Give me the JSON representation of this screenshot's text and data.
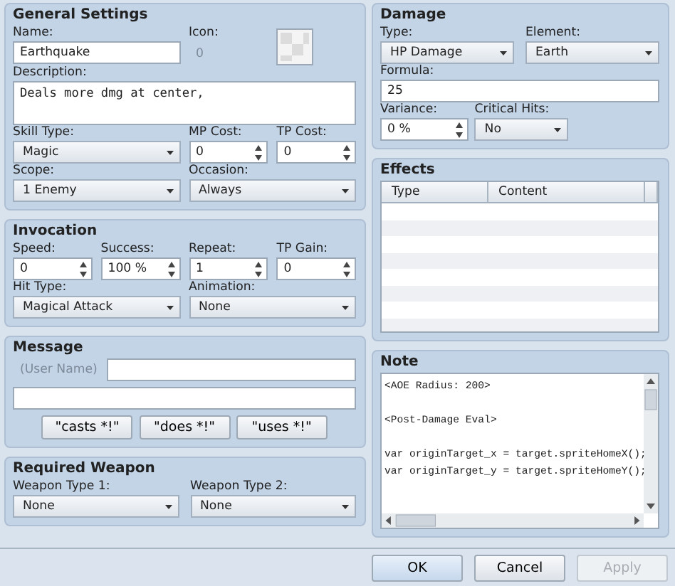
{
  "general": {
    "title": "General Settings",
    "name": {
      "label": "Name:",
      "value": "Earthquake"
    },
    "icon": {
      "label": "Icon:",
      "index": "0"
    },
    "description": {
      "label": "Description:",
      "value": "Deals more dmg at center,"
    },
    "skill_type": {
      "label": "Skill Type:",
      "value": "Magic"
    },
    "mp_cost": {
      "label": "MP Cost:",
      "value": "0"
    },
    "tp_cost": {
      "label": "TP Cost:",
      "value": "0"
    },
    "scope": {
      "label": "Scope:",
      "value": "1 Enemy"
    },
    "occasion": {
      "label": "Occasion:",
      "value": "Always"
    }
  },
  "invocation": {
    "title": "Invocation",
    "speed": {
      "label": "Speed:",
      "value": "0"
    },
    "success": {
      "label": "Success:",
      "value": "100 %"
    },
    "repeat": {
      "label": "Repeat:",
      "value": "1"
    },
    "tp_gain": {
      "label": "TP Gain:",
      "value": "0"
    },
    "hit_type": {
      "label": "Hit Type:",
      "value": "Magical Attack"
    },
    "animation": {
      "label": "Animation:",
      "value": "None"
    }
  },
  "message": {
    "title": "Message",
    "user_name": "(User Name)",
    "buttons": [
      "\"casts *!\"",
      "\"does *!\"",
      "\"uses *!\""
    ]
  },
  "required_weapon": {
    "title": "Required Weapon",
    "weapon_type_1": {
      "label": "Weapon Type 1:",
      "value": "None"
    },
    "weapon_type_2": {
      "label": "Weapon Type 2:",
      "value": "None"
    }
  },
  "damage": {
    "title": "Damage",
    "type": {
      "label": "Type:",
      "value": "HP Damage"
    },
    "element": {
      "label": "Element:",
      "value": "Earth"
    },
    "formula": {
      "label": "Formula:",
      "value": "25"
    },
    "variance": {
      "label": "Variance:",
      "value": "0 %"
    },
    "critical_hits": {
      "label": "Critical Hits:",
      "value": "No"
    }
  },
  "effects": {
    "title": "Effects",
    "columns": [
      "Type",
      "Content"
    ]
  },
  "note": {
    "title": "Note",
    "paragraphs": [
      [
        "<AOE Radius: 200>"
      ],
      [
        "<Post-Damage Eval>"
      ],
      [
        "var originTarget_x = target.spriteHomeX();",
        "var originTarget_y = target.spriteHomeY();"
      ]
    ]
  },
  "buttons": [
    {
      "label": "OK",
      "disabled": false
    },
    {
      "label": "Cancel",
      "disabled": false
    },
    {
      "label": "Apply",
      "disabled": true
    }
  ]
}
